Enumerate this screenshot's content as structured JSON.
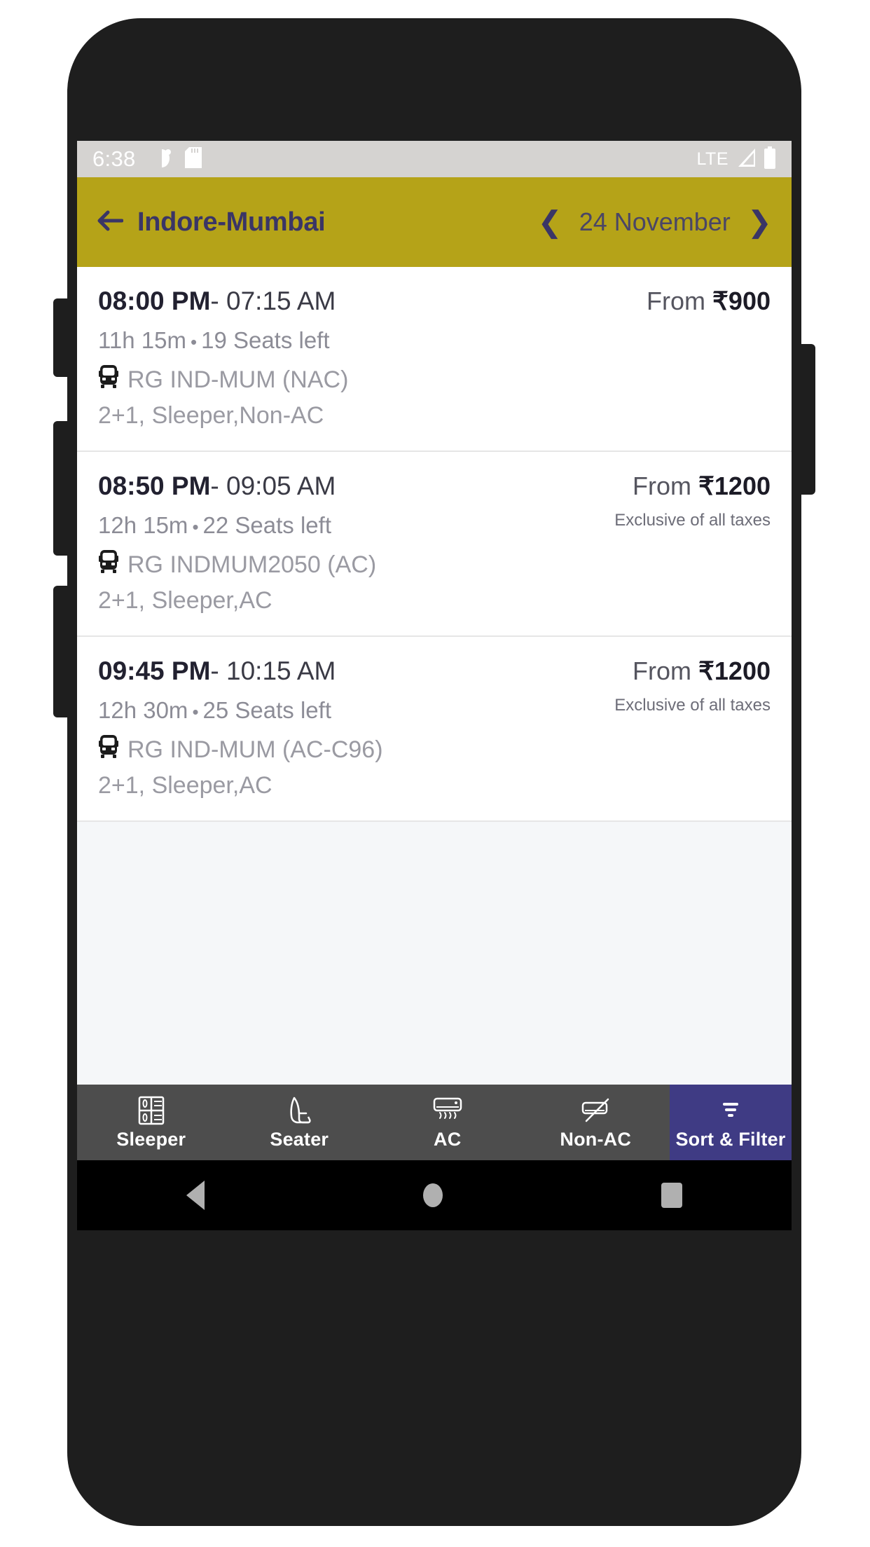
{
  "status_bar": {
    "time": "6:38",
    "network": "LTE",
    "icons": [
      "do-not-disturb-icon",
      "sd-card-icon",
      "signal-icon",
      "battery-icon"
    ]
  },
  "app_bar": {
    "back_icon": "arrow-left-icon",
    "route_title": "Indore-Mumbai",
    "prev_icon": "chevron-left-icon",
    "date": "24 November",
    "next_icon": "chevron-right-icon",
    "background_color": "#b5a318",
    "title_color": "#3a3566"
  },
  "bus_list": [
    {
      "departure": "08:00 PM",
      "separator": "-",
      "arrival": "07:15 AM",
      "duration": "11h 15m",
      "dot": "•",
      "seats": "19 Seats left",
      "bus_icon": "bus-icon",
      "operator": "RG IND-MUM (NAC)",
      "layout": "2+1, Sleeper,Non-AC",
      "price_prefix": "From",
      "currency": "₹",
      "price": "900",
      "tax_note": ""
    },
    {
      "departure": "08:50 PM",
      "separator": "-",
      "arrival": "09:05 AM",
      "duration": "12h 15m",
      "dot": "•",
      "seats": "22 Seats left",
      "bus_icon": "bus-icon",
      "operator": "RG INDMUM2050 (AC)",
      "layout": "2+1, Sleeper,AC",
      "price_prefix": "From",
      "currency": "₹",
      "price": "1200",
      "tax_note": "Exclusive of all taxes"
    },
    {
      "departure": "09:45 PM",
      "separator": "-",
      "arrival": "10:15 AM",
      "duration": "12h 30m",
      "dot": "•",
      "seats": "25 Seats left",
      "bus_icon": "bus-icon",
      "operator": "RG IND-MUM (AC-C96)",
      "layout": "2+1, Sleeper,AC",
      "price_prefix": "From",
      "currency": "₹",
      "price": "1200",
      "tax_note": "Exclusive of all taxes"
    }
  ],
  "filter_bar": {
    "background_color": "#4d4d4d",
    "accent_color": "#3f3b84",
    "items": [
      {
        "label": "Sleeper",
        "icon": "sleeper-berth-icon",
        "selected": false
      },
      {
        "label": "Seater",
        "icon": "seat-icon",
        "selected": false
      },
      {
        "label": "AC",
        "icon": "air-conditioner-icon",
        "selected": false
      },
      {
        "label": "Non-AC",
        "icon": "air-conditioner-crossed-icon",
        "selected": false
      },
      {
        "label": "Sort & Filter",
        "icon": "filter-icon",
        "selected": true
      }
    ]
  },
  "android_nav": {
    "back": "back-triangle-icon",
    "home": "home-circle-icon",
    "recents": "recents-square-icon"
  }
}
